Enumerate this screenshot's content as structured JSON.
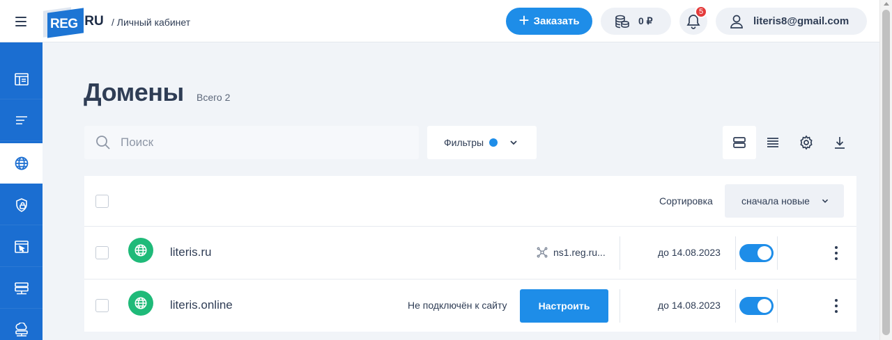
{
  "header": {
    "logo_main": "REG",
    "logo_suffix": ".RU",
    "breadcrumb": "/ Личный кабинет",
    "order_label": "Заказать",
    "balance": "0 ₽",
    "notifications_count": "5",
    "user_email": "literis8@gmail.com"
  },
  "sidebar": {
    "items": [
      {
        "icon": "dashboard-icon",
        "active": false
      },
      {
        "icon": "list-icon",
        "active": false
      },
      {
        "icon": "globe-icon",
        "active": true
      },
      {
        "icon": "shield-lock-icon",
        "active": false
      },
      {
        "icon": "window-cursor-icon",
        "active": false
      },
      {
        "icon": "server-icon",
        "active": false
      },
      {
        "icon": "cloud-server-icon",
        "active": false
      }
    ]
  },
  "main": {
    "title": "Домены",
    "total": "Всего 2",
    "search_placeholder": "Поиск",
    "filters_label": "Фильтры",
    "sort_label": "Сортировка",
    "sort_value": "сначала новые",
    "accent_color": "#1e8de8",
    "domains": [
      {
        "name": "literis.ru",
        "ns": "ns1.reg.ru...",
        "status": "",
        "date": "до 14.08.2023",
        "enabled": true
      },
      {
        "name": "literis.online",
        "ns": "",
        "status": "Не подключён к сайту",
        "action": "Настроить",
        "date": "до 14.08.2023",
        "enabled": true
      }
    ]
  }
}
